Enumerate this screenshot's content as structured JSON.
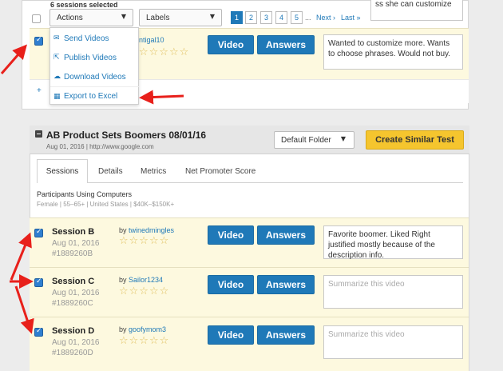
{
  "toolbar": {
    "selected_count": "6 sessions selected",
    "actions_label": "Actions",
    "labels_label": "Labels",
    "pages": [
      "1",
      "2",
      "3",
      "4",
      "5"
    ],
    "ellipsis": "...",
    "next": "Next ›",
    "last": "Last »"
  },
  "actions_menu": {
    "items": [
      {
        "label": "Send Videos",
        "icon": "send-icon"
      },
      {
        "label": "Publish Videos",
        "icon": "publish-icon"
      },
      {
        "label": "Download Videos",
        "icon": "download-icon"
      },
      {
        "label": "Export to Excel",
        "icon": "table-icon"
      }
    ]
  },
  "top_session": {
    "by_fragment": "ntigal10",
    "top_note_fragment": "ss she can customize",
    "note": "Wanted to customize more.  Wants to choose phrases.  Would not buy."
  },
  "test": {
    "title": "AB Product Sets Boomers 08/01/16",
    "meta": "Aug 01, 2016 | http://www.google.com",
    "folder": "Default Folder",
    "create_button": "Create Similar Test",
    "tabs": [
      "Sessions",
      "Details",
      "Metrics",
      "Net Promoter Score"
    ],
    "participants_heading": "Participants Using Computers",
    "participants_detail": "Female | 55–65+ | United States | $40K–$150K+"
  },
  "buttons": {
    "video": "Video",
    "answers": "Answers"
  },
  "sessions": [
    {
      "title": "Session B",
      "date": "Aug 01, 2016",
      "id": "#1889260B",
      "by": "by",
      "user": "twinedmingles",
      "note": "Favorite boomer.  Liked Right justified mostly because of the description info."
    },
    {
      "title": "Session C",
      "date": "Aug 01, 2016",
      "id": "#1889260C",
      "by": "by",
      "user": "Sailor1234",
      "placeholder": "Summarize this video"
    },
    {
      "title": "Session D",
      "date": "Aug 01, 2016",
      "id": "#1889260D",
      "by": "by",
      "user": "goofymom3",
      "placeholder": "Summarize this video"
    }
  ],
  "stars": "☆☆☆☆☆",
  "colors": {
    "primary": "#1f79b8",
    "create": "#f5c52e",
    "row_bg": "#fdf9df",
    "arrow": "#e8201b"
  }
}
